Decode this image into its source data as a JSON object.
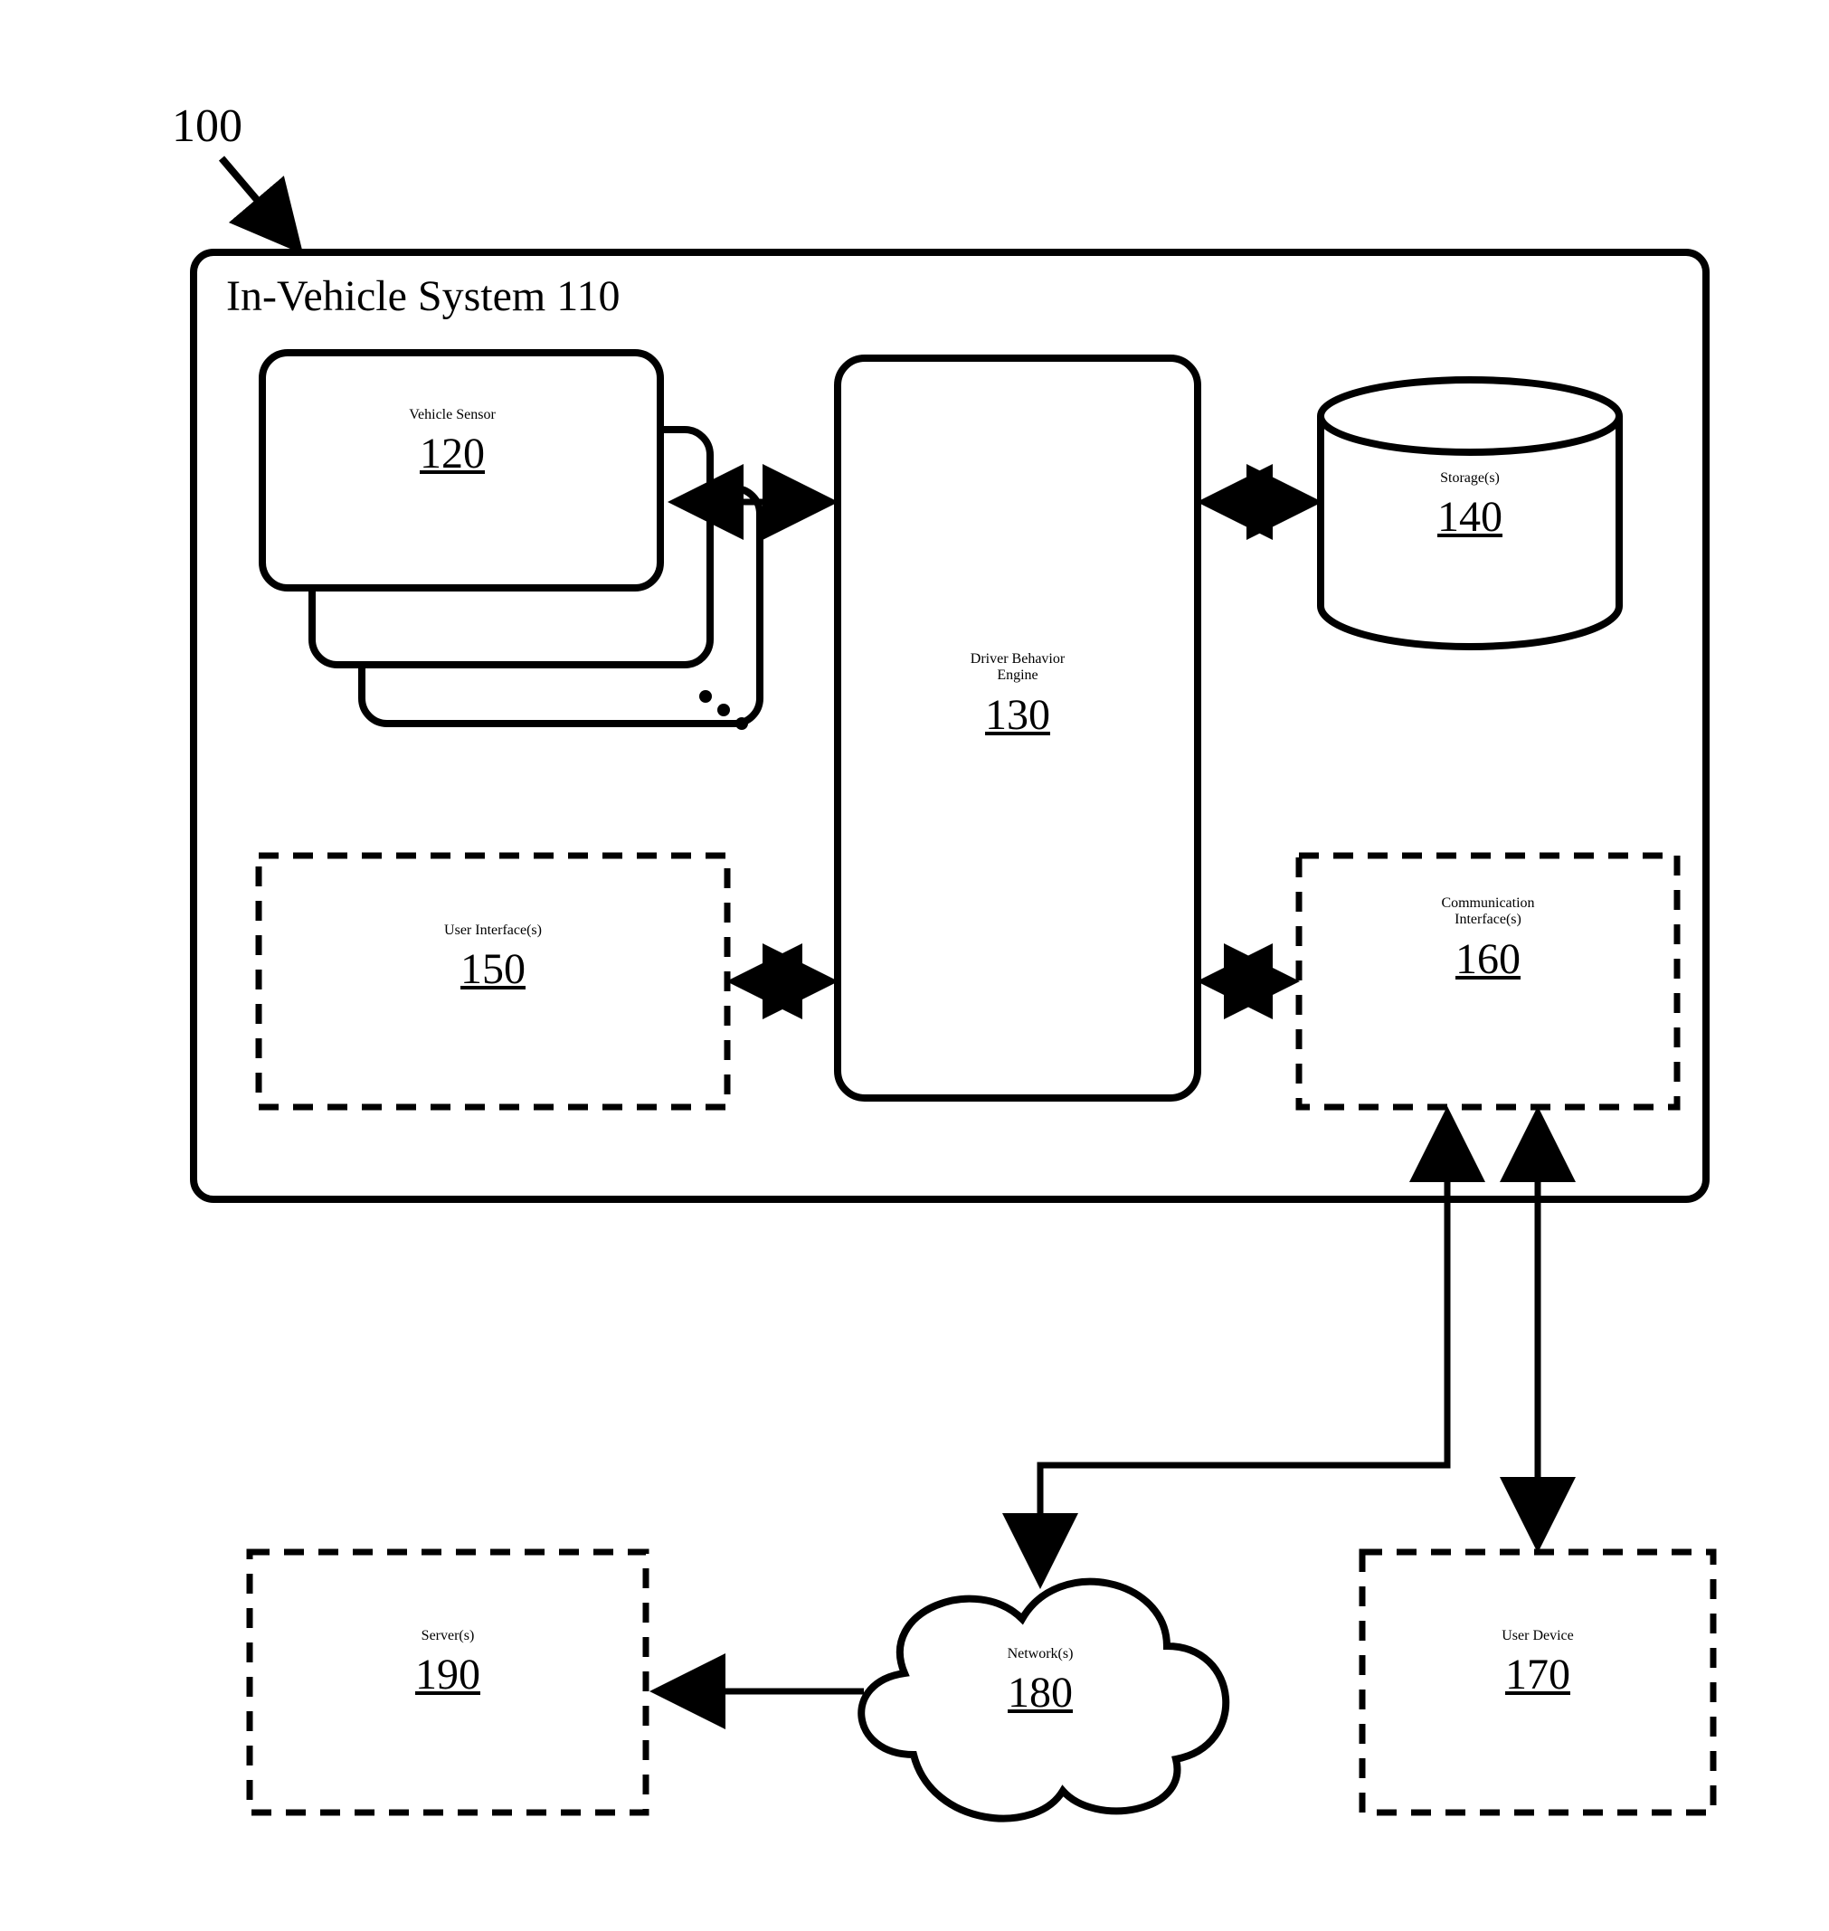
{
  "figure_ref": "100",
  "system_title": "In-Vehicle System 110",
  "blocks": {
    "vehicle_sensor": {
      "label": "Vehicle Sensor",
      "ref": "120"
    },
    "dbe": {
      "label": "Driver Behavior\nEngine",
      "ref": "130"
    },
    "storage": {
      "label": "Storage(s)",
      "ref": "140"
    },
    "ui": {
      "label": "User Interface(s)",
      "ref": "150"
    },
    "comm": {
      "label": "Communication\nInterface(s)",
      "ref": "160"
    },
    "user_device": {
      "label": "User Device",
      "ref": "170"
    },
    "network": {
      "label": "Network(s)",
      "ref": "180"
    },
    "server": {
      "label": "Server(s)",
      "ref": "190"
    }
  },
  "connections": [
    "vehicle_sensor<->dbe",
    "dbe<->storage",
    "ui<->dbe",
    "dbe<->comm",
    "comm->network",
    "comm->user_device",
    "network->server"
  ]
}
